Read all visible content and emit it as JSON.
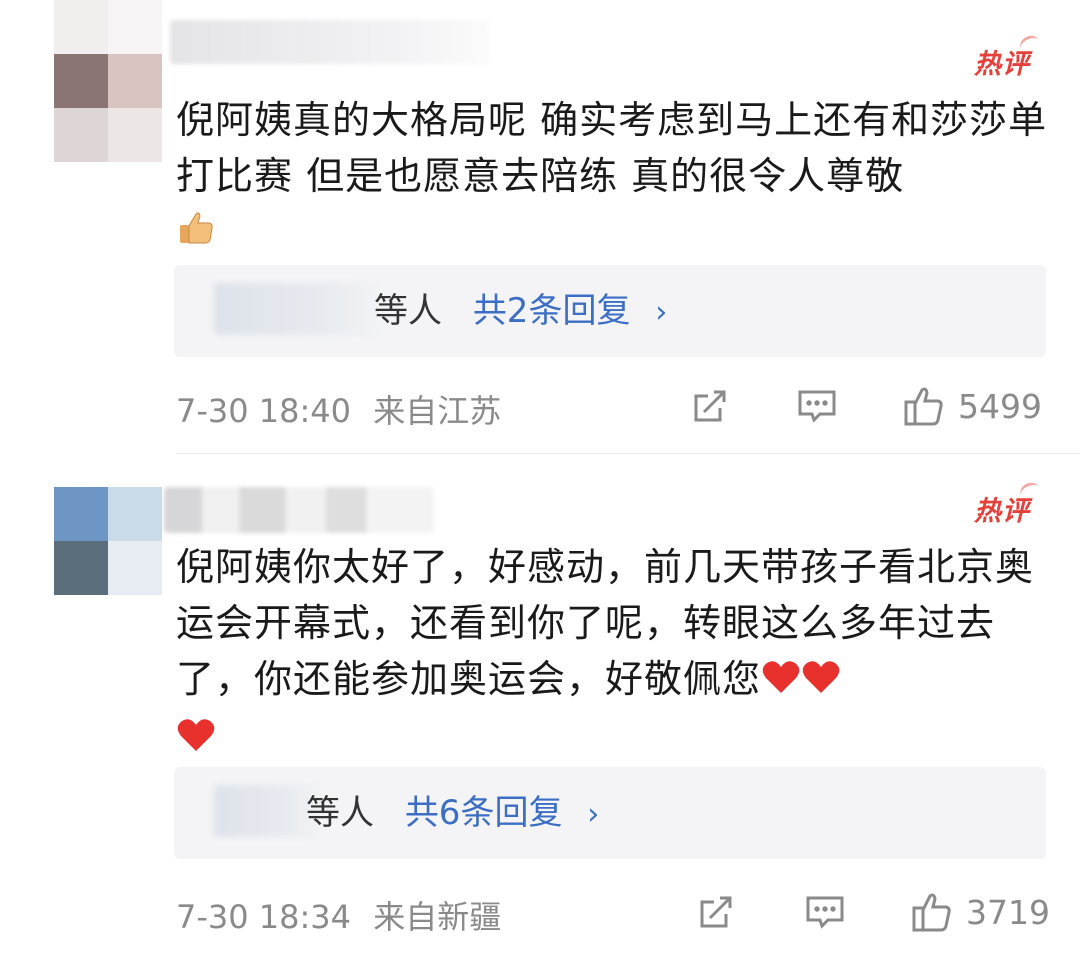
{
  "comments": [
    {
      "badge": "热评",
      "content_text": "倪阿姨真的大格局呢 确实考虑到马上还有和莎莎单打比赛 但是也愿意去陪练 真的很令人尊敬",
      "emoji": "thumbs-up",
      "reply_suffix": "等人",
      "reply_link": "共2条回复",
      "timestamp": "7-30 18:40",
      "location": "来自江苏",
      "likes": "5499"
    },
    {
      "badge": "热评",
      "content_text": "倪阿姨你太好了，好感动，前几天带孩子看北京奥运会开幕式，还看到你了呢，转眼这么多年过去了，你还能参加奥运会，好敬佩您",
      "emoji": "red-heart x3",
      "reply_suffix": "等人",
      "reply_link": "共6条回复",
      "timestamp": "7-30 18:34",
      "location": "来自新疆",
      "likes": "3719"
    }
  ],
  "icons": {
    "share": "share-icon",
    "comment": "comment-icon",
    "like": "like-icon",
    "chevron": "chevron-right-icon"
  },
  "colors": {
    "hot_badge": "#e5403a",
    "reply_link": "#3b6ec4",
    "meta_text": "#8a8a8a",
    "reply_bg": "#f4f4f6",
    "heart": "#e8302c"
  }
}
